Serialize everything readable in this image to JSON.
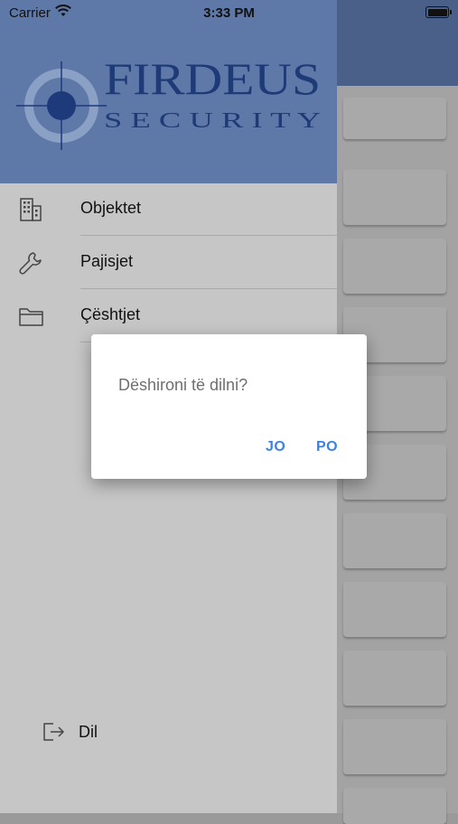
{
  "status_bar": {
    "carrier": "Carrier",
    "time": "3:33 PM"
  },
  "logo": {
    "brand_name": "FIRDEUS",
    "brand_sub": "SECURITY"
  },
  "menu": {
    "items": [
      {
        "label": "Objektet",
        "icon": "building-icon"
      },
      {
        "label": "Pajisjet",
        "icon": "wrench-icon"
      },
      {
        "label": "Çështjet",
        "icon": "folder-icon"
      }
    ],
    "logout_label": "Dil"
  },
  "dialog": {
    "message": "Dëshironi të dilni?",
    "no_label": "JO",
    "yes_label": "PO"
  },
  "colors": {
    "drawer_header": "#5e78a8",
    "accent_button": "#3b82e6",
    "drawer_bg": "#c6c6c6"
  }
}
